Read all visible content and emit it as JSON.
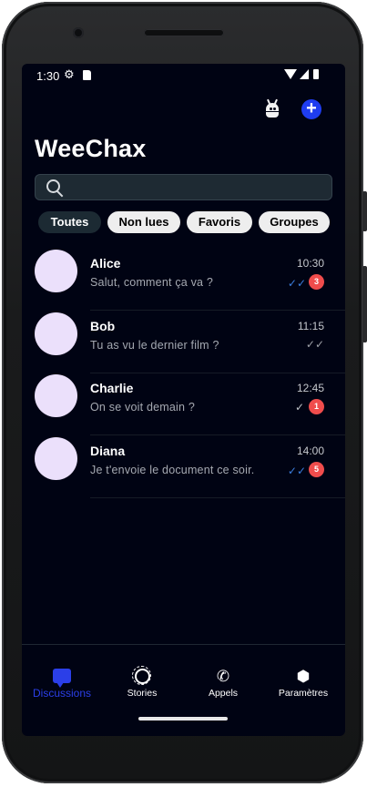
{
  "status_bar": {
    "time": "1:30"
  },
  "header": {
    "title": "WeeChax",
    "android_icon": "android-robot-icon",
    "new_chat_label": "+"
  },
  "search": {
    "placeholder": "",
    "value": ""
  },
  "filters": [
    {
      "label": "Toutes",
      "active": true
    },
    {
      "label": "Non lues",
      "active": false
    },
    {
      "label": "Favoris",
      "active": false
    },
    {
      "label": "Groupes",
      "active": false
    }
  ],
  "conversations": [
    {
      "name": "Alice",
      "preview": "Salut, comment ça va ?",
      "time": "10:30",
      "status": "read",
      "unread": "3"
    },
    {
      "name": "Bob",
      "preview": "Tu as vu le dernier film ?",
      "time": "11:15",
      "status": "delivered",
      "unread": ""
    },
    {
      "name": "Charlie",
      "preview": "On se voit demain ?",
      "time": "12:45",
      "status": "sent",
      "unread": "1"
    },
    {
      "name": "Diana",
      "preview": "Je t'envoie le document ce soir.",
      "time": "14:00",
      "status": "read",
      "unread": "5"
    }
  ],
  "bottom_nav": [
    {
      "label": "Discussions",
      "icon": "chat-bubble-icon",
      "active": true
    },
    {
      "label": "Stories",
      "icon": "stories-icon",
      "active": false
    },
    {
      "label": "Appels",
      "icon": "phone-icon",
      "active": false
    },
    {
      "label": "Paramètres",
      "icon": "settings-hexagon-icon",
      "active": false
    }
  ],
  "colors": {
    "background": "#000313",
    "accent": "#2b3fe8",
    "badge": "#f04c4c",
    "read_ticks": "#3b7ddd",
    "avatar": "#ebe0fb"
  }
}
